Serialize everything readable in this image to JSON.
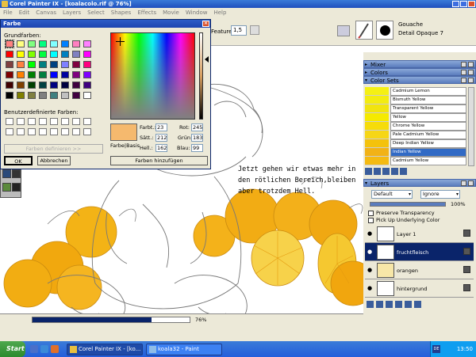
{
  "app": {
    "title": "Corel Painter IX - [koalacolo.rif @ 76%]"
  },
  "menu": [
    "File",
    "Edit",
    "Canvas",
    "Layers",
    "Select",
    "Shapes",
    "Effects",
    "Movie",
    "Window",
    "Help"
  ],
  "propbar": {
    "feature_label": "Feature:",
    "feature_value": "1,5"
  },
  "brush": {
    "category": "Gouache",
    "variant": "Detail Opaque 7"
  },
  "dialog": {
    "title": "Farbe",
    "basic_colors_label": "Grundfarben:",
    "custom_colors_label": "Benutzerdefinierte Farben:",
    "define_button": "Farben definieren >>",
    "ok_button": "OK",
    "cancel_button": "Abbrechen",
    "preview_label": "Farbe|Basis",
    "add_button": "Farben hinzufügen",
    "hue_label": "Farbt.:",
    "hue_value": "23",
    "sat_label": "Sätt.:",
    "sat_value": "212",
    "lum_label": "Hell.:",
    "lum_value": "162",
    "red_label": "Rot:",
    "red_value": "245",
    "green_label": "Grün:",
    "green_value": "183",
    "blue_label": "Blau:",
    "blue_value": "99",
    "basic_colors": [
      "#ff8080",
      "#ffff80",
      "#80ff80",
      "#00ff80",
      "#80ffff",
      "#0080ff",
      "#ff80c0",
      "#ff80ff",
      "#ff0000",
      "#ffff00",
      "#80ff00",
      "#00ff40",
      "#00ffff",
      "#0080c0",
      "#8080c0",
      "#ff00ff",
      "#804040",
      "#ff8040",
      "#00ff00",
      "#008080",
      "#004080",
      "#8080ff",
      "#800040",
      "#ff0080",
      "#800000",
      "#ff8000",
      "#008000",
      "#008040",
      "#0000ff",
      "#0000a0",
      "#800080",
      "#8000ff",
      "#400000",
      "#804000",
      "#004000",
      "#004040",
      "#000080",
      "#000040",
      "#400040",
      "#400080",
      "#000000",
      "#808000",
      "#808040",
      "#808080",
      "#408080",
      "#c0c0c0",
      "#400040",
      "#ffffff"
    ]
  },
  "canvas": {
    "instruction_lines": [
      "Jetzt gehen wir etwas mehr in",
      "den rötlichen Bereich,bleiben",
      "aber trotzdem Hell."
    ]
  },
  "panels": {
    "mixer": "Mixer",
    "colors": "Colors",
    "color_sets": "Color Sets",
    "color_set_items": [
      {
        "name": "Cadmium Lemon",
        "color": "#f5f014"
      },
      {
        "name": "Bismuth Yellow",
        "color": "#f3ec10"
      },
      {
        "name": "Transparent Yellow",
        "color": "#f1e40e"
      },
      {
        "name": "Yellow",
        "color": "#f5ea00"
      },
      {
        "name": "Chrome Yellow",
        "color": "#f6dc0a"
      },
      {
        "name": "Pale Cadmium Yellow",
        "color": "#f6d616"
      },
      {
        "name": "Deep Indian Yellow",
        "color": "#f4c20c"
      },
      {
        "name": "Indian Yellow",
        "color": "#f2b216"
      },
      {
        "name": "Cadmium Yellow",
        "color": "#f4ba12"
      }
    ],
    "layers": "Layers",
    "composite_method": "Default",
    "composite_depth": "Ignore",
    "opacity": "100%",
    "preserve_transparency": "Preserve Transparency",
    "pick_underlying": "Pick Up Underlying Color",
    "layer_items": [
      "Layer 1",
      "fruchtfleisch",
      "orangen",
      "hintergrund"
    ]
  },
  "status": {
    "zoom": "76%",
    "zoom_fraction": 0.76
  },
  "taskbar": {
    "start": "Start",
    "tasks": [
      "Corel Painter IX - [ko...",
      "koala32 - Paint"
    ],
    "lang": "DE",
    "clock": "13:50"
  }
}
